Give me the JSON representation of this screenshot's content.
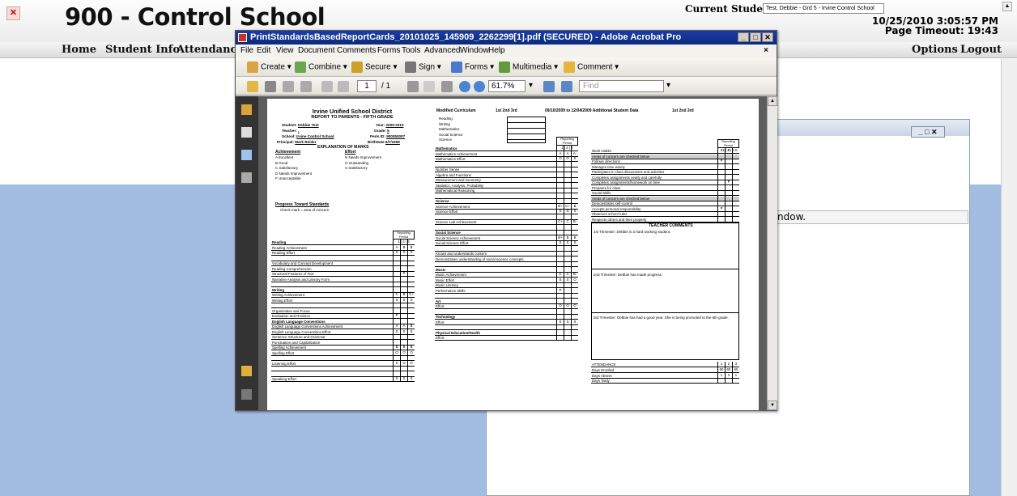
{
  "sis": {
    "title": "900 - Control School",
    "current_student_label": "Current Student:",
    "current_student_value": "Test, Debbie - Grd 5 - Irvine Control School",
    "datetime": "10/25/2010 3:05:57 PM",
    "page_timeout": "Page Timeout: 19:43",
    "nav": [
      "Home",
      "Student Info",
      "Attendance"
    ],
    "nav_right": [
      "Options",
      "Logout"
    ]
  },
  "bg_window": {
    "text_fragment": "ndow."
  },
  "acrobat": {
    "title": "PrintStandardsBasedReportCards_20101025_145909_2262299[1].pdf (SECURED) - Adobe Acrobat Pro",
    "menu": [
      "File",
      "Edit",
      "View",
      "Document",
      "Comments",
      "Forms",
      "Tools",
      "Advanced",
      "Window",
      "Help"
    ],
    "toolbar1": [
      "Create",
      "Combine",
      "Secure",
      "Sign",
      "Forms",
      "Multimedia",
      "Comment"
    ],
    "page_current": "1",
    "page_total": "/ 1",
    "zoom": "61.7%",
    "find_placeholder": "Find"
  },
  "report": {
    "district": "Irvine Unified School District",
    "subtitle": "REPORT TO PARENTS - FIFTH GRADE",
    "student_label": "Student:",
    "student": "Debbie Test",
    "teacher_label": "Teacher:",
    "teacher": ",",
    "school_label": "School:",
    "school": "Irvine Control School",
    "principal_label": "Principal:",
    "principal": "Mark Reider",
    "year_label": "Year:",
    "year": "2009-2010",
    "grade_label": "Grade:",
    "grade": "5",
    "perm_label": "Perm ID:",
    "perm": "900050007",
    "birth_label": "BirthDate",
    "birth": "6/7/1999",
    "marks_title": "EXPLANATION OF MARKS",
    "ach_h": "Achievement",
    "eff_h": "Effort",
    "ach": [
      "A   Excellent",
      "B   Good",
      "C   Satisfactory",
      "D   Needs Improvement",
      "F   Unacceptable"
    ],
    "eff": [
      "N   Needs Improvement",
      "O   Outstanding",
      "S   Satisfactory"
    ],
    "progress_h": "Progress Toward Standards",
    "progress_t": "Check mark = area of concern",
    "rp": "Reporting Period",
    "rp_nums": [
      "1",
      "2",
      "3"
    ],
    "left_rows": [
      {
        "l": "Reading",
        "s": true,
        "v": [
          "",
          "",
          ""
        ]
      },
      {
        "l": "Reading Achievement",
        "v": [
          "A",
          "B",
          "B"
        ]
      },
      {
        "l": "Reading Effort",
        "v": [
          "S",
          "S",
          "S"
        ]
      },
      {
        "l": "",
        "v": [
          "",
          "",
          ""
        ]
      },
      {
        "l": "Vocabulary and Concept Development",
        "v": [
          "",
          "",
          ""
        ]
      },
      {
        "l": "Reading Comprehension",
        "v": [
          "",
          "",
          ""
        ]
      },
      {
        "l": "Structural Features of Text",
        "v": [
          "",
          "P",
          ""
        ]
      },
      {
        "l": "Narrative Analysis and Literary Form",
        "v": [
          "",
          "",
          ""
        ]
      },
      {
        "l": "",
        "v": [
          "",
          "",
          ""
        ]
      },
      {
        "l": "Writing",
        "s": true,
        "v": [
          "",
          "",
          ""
        ]
      },
      {
        "l": "Writing Achievement",
        "v": [
          "C",
          "B",
          "C+"
        ]
      },
      {
        "l": "Writing Effort",
        "v": [
          "S",
          "S",
          "S"
        ]
      },
      {
        "l": "",
        "v": [
          "",
          "",
          ""
        ]
      },
      {
        "l": "Organization and Focus",
        "v": [
          "",
          "",
          ""
        ]
      },
      {
        "l": "Evaluation and Revision",
        "v": [
          "P",
          "",
          ""
        ]
      },
      {
        "l": "English Language Conventions",
        "s": true,
        "v": [
          "",
          "",
          ""
        ]
      },
      {
        "l": "English Language Conventions Achievement",
        "v": [
          "A",
          "A",
          "B"
        ]
      },
      {
        "l": "English Language Conventions Effort",
        "v": [
          "S",
          "S",
          "S"
        ]
      },
      {
        "l": "Sentence Structure and Grammar",
        "v": [
          "",
          "",
          ""
        ]
      },
      {
        "l": "Punctuation and Capitalization",
        "v": [
          "",
          "",
          ""
        ]
      },
      {
        "l": "Spelling Achievement",
        "v": [
          "B",
          "B",
          "B"
        ]
      },
      {
        "l": "Spelling Effort",
        "v": [
          "O",
          "O",
          "O"
        ]
      },
      {
        "l": "",
        "v": [
          "",
          "",
          ""
        ]
      },
      {
        "l": "Listening Effort",
        "v": [
          "S",
          "O",
          "O"
        ]
      },
      {
        "l": "",
        "v": [
          "",
          "",
          ""
        ]
      },
      {
        "l": "",
        "v": [
          "",
          "",
          ""
        ]
      },
      {
        "l": "Speaking Effort",
        "v": [
          "S",
          "S",
          "S"
        ]
      }
    ],
    "mod_h": "Modified Curriculum",
    "mod_cols": "1st   2nd   3rd",
    "mod_items": [
      "Reading",
      "Writing",
      "Mathematics",
      "Social Science",
      "Science"
    ],
    "mid_rows": [
      {
        "l": "Mathematics",
        "s": true,
        "v": [
          "",
          "",
          ""
        ]
      },
      {
        "l": "Mathematics Achievement",
        "v": [
          "A",
          "A",
          "A-"
        ]
      },
      {
        "l": "Mathematics Effort",
        "v": [
          "O",
          "O",
          "S"
        ]
      },
      {
        "l": "",
        "v": [
          "",
          "",
          ""
        ]
      },
      {
        "l": "Number Sense",
        "v": [
          "",
          "",
          ""
        ]
      },
      {
        "l": "Algebra and Functions",
        "v": [
          "",
          "",
          ""
        ]
      },
      {
        "l": "Measurement and Geometry",
        "v": [
          "",
          "",
          ""
        ]
      },
      {
        "l": "Statistics, Analysis, Probability",
        "v": [
          "",
          "",
          ""
        ]
      },
      {
        "l": "Mathematical Reasoning",
        "v": [
          "",
          "",
          ""
        ]
      },
      {
        "l": "",
        "v": [
          "",
          "",
          ""
        ]
      },
      {
        "l": "Science",
        "s": true,
        "v": [
          "",
          "",
          ""
        ]
      },
      {
        "l": "Science Achievement",
        "v": [
          "B+",
          "C+",
          "B"
        ]
      },
      {
        "l": "Science Effort",
        "v": [
          "S",
          "N",
          "S"
        ]
      },
      {
        "l": "",
        "v": [
          "",
          "",
          ""
        ]
      },
      {
        "l": "Science Lab Achievement",
        "v": [
          "C+",
          "C",
          "B-"
        ]
      },
      {
        "l": "",
        "v": [
          "",
          "",
          ""
        ]
      },
      {
        "l": "Social Science",
        "s": true,
        "v": [
          "",
          "",
          ""
        ]
      },
      {
        "l": "Social Science Achievement",
        "v": [
          "B+",
          "B",
          "B"
        ]
      },
      {
        "l": "Social Science Effort",
        "v": [
          "S",
          "S",
          "S"
        ]
      },
      {
        "l": "",
        "v": [
          "",
          "",
          ""
        ]
      },
      {
        "l": "Knows and understands content",
        "v": [
          "",
          "",
          ""
        ]
      },
      {
        "l": "Demonstrates understanding of social science concepts",
        "v": [
          "",
          "",
          ""
        ]
      },
      {
        "l": "",
        "v": [
          "",
          "",
          ""
        ]
      },
      {
        "l": "Music",
        "s": true,
        "v": [
          "",
          "",
          ""
        ]
      },
      {
        "l": "Music Achievement",
        "v": [
          "C",
          "C",
          "B-"
        ]
      },
      {
        "l": "Music Effort",
        "v": [
          "S",
          "S",
          "O"
        ]
      },
      {
        "l": "Music Literacy",
        "v": [
          "",
          "",
          ""
        ]
      },
      {
        "l": "Performance Skills",
        "v": [
          "P",
          "",
          ""
        ]
      },
      {
        "l": "",
        "v": [
          "",
          "",
          ""
        ]
      },
      {
        "l": "Art",
        "s": true,
        "v": [
          "",
          "",
          ""
        ]
      },
      {
        "l": "Effort",
        "v": [
          "O",
          "O",
          "O"
        ]
      },
      {
        "l": "",
        "v": [
          "",
          "",
          ""
        ]
      },
      {
        "l": "Technology",
        "s": true,
        "v": [
          "",
          "",
          ""
        ]
      },
      {
        "l": "Effort",
        "v": [
          "S",
          "S",
          "S"
        ]
      },
      {
        "l": "",
        "v": [
          "",
          "",
          ""
        ]
      },
      {
        "l": "Physical Education/Health",
        "s": true,
        "v": [
          "",
          "",
          ""
        ]
      },
      {
        "l": "Effort",
        "v": [
          "",
          "",
          ""
        ]
      }
    ],
    "addl_h": "09/10/2009 to 12/04/2009  Additional Student Data",
    "addl_cols": "1st   2nd   3rd",
    "right_rows": [
      {
        "l": "Work Habits",
        "v": [
          "S",
          "S",
          "S"
        ]
      },
      {
        "l": "Areas of concern are checked below",
        "sh": true,
        "v": [
          "",
          "",
          ""
        ]
      },
      {
        "l": "Follows directions",
        "v": [
          "P",
          "",
          ""
        ]
      },
      {
        "l": "Manages time wisely",
        "v": [
          "",
          "",
          ""
        ]
      },
      {
        "l": "Participates in class discussions and activities",
        "v": [
          "",
          "",
          ""
        ]
      },
      {
        "l": "Completes assignments neatly and carefully",
        "v": [
          "",
          "",
          ""
        ]
      },
      {
        "l": "Completes assignments/homework  on time",
        "v": [
          "",
          "P",
          ""
        ]
      },
      {
        "l": "Prepares for class",
        "v": [
          "",
          "",
          ""
        ]
      },
      {
        "l": "Social Skills",
        "v": [
          "",
          "",
          ""
        ]
      },
      {
        "l": "Areas of concern are checked below",
        "sh": true,
        "v": [
          "",
          "",
          ""
        ]
      },
      {
        "l": "Demonstrates self-control",
        "v": [
          "",
          "",
          ""
        ]
      },
      {
        "l": "Accepts personal responsibility",
        "v": [
          "P",
          "",
          ""
        ]
      },
      {
        "l": "Observes school rules",
        "v": [
          "",
          "",
          ""
        ]
      },
      {
        "l": "Respects others and their property",
        "v": [
          "",
          "",
          ""
        ]
      }
    ],
    "comments_h": "TEACHER COMMENTS",
    "comments": [
      "1st Trimester:  Debbie is a hard working student.",
      "2nd Trimester:  Debbie has made progress.",
      "3rd Trimester:  Debbie has had a good year.  She is being promoted to the 6th grade."
    ],
    "attendance_h": "ATTENDANCE",
    "att_rows": [
      {
        "l": "Days Enrolled",
        "v": [
          "60",
          "60",
          "60"
        ]
      },
      {
        "l": "Days Absent",
        "v": [
          "1",
          "3",
          "1"
        ]
      },
      {
        "l": "Days Tardy",
        "v": [
          "",
          "",
          ""
        ]
      }
    ]
  }
}
